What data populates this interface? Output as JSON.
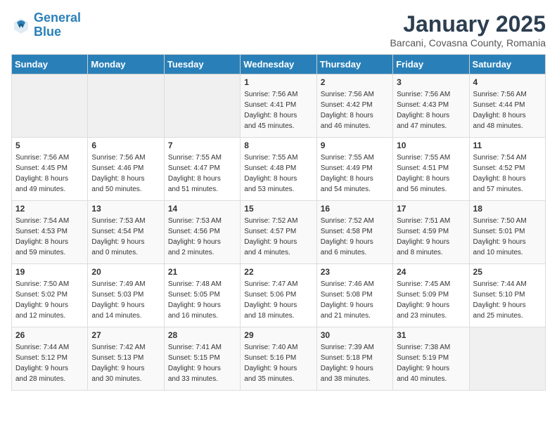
{
  "logo": {
    "line1": "General",
    "line2": "Blue"
  },
  "title": "January 2025",
  "subtitle": "Barcani, Covasna County, Romania",
  "weekdays": [
    "Sunday",
    "Monday",
    "Tuesday",
    "Wednesday",
    "Thursday",
    "Friday",
    "Saturday"
  ],
  "weeks": [
    [
      {
        "day": "",
        "info": ""
      },
      {
        "day": "",
        "info": ""
      },
      {
        "day": "",
        "info": ""
      },
      {
        "day": "1",
        "info": "Sunrise: 7:56 AM\nSunset: 4:41 PM\nDaylight: 8 hours\nand 45 minutes."
      },
      {
        "day": "2",
        "info": "Sunrise: 7:56 AM\nSunset: 4:42 PM\nDaylight: 8 hours\nand 46 minutes."
      },
      {
        "day": "3",
        "info": "Sunrise: 7:56 AM\nSunset: 4:43 PM\nDaylight: 8 hours\nand 47 minutes."
      },
      {
        "day": "4",
        "info": "Sunrise: 7:56 AM\nSunset: 4:44 PM\nDaylight: 8 hours\nand 48 minutes."
      }
    ],
    [
      {
        "day": "5",
        "info": "Sunrise: 7:56 AM\nSunset: 4:45 PM\nDaylight: 8 hours\nand 49 minutes."
      },
      {
        "day": "6",
        "info": "Sunrise: 7:56 AM\nSunset: 4:46 PM\nDaylight: 8 hours\nand 50 minutes."
      },
      {
        "day": "7",
        "info": "Sunrise: 7:55 AM\nSunset: 4:47 PM\nDaylight: 8 hours\nand 51 minutes."
      },
      {
        "day": "8",
        "info": "Sunrise: 7:55 AM\nSunset: 4:48 PM\nDaylight: 8 hours\nand 53 minutes."
      },
      {
        "day": "9",
        "info": "Sunrise: 7:55 AM\nSunset: 4:49 PM\nDaylight: 8 hours\nand 54 minutes."
      },
      {
        "day": "10",
        "info": "Sunrise: 7:55 AM\nSunset: 4:51 PM\nDaylight: 8 hours\nand 56 minutes."
      },
      {
        "day": "11",
        "info": "Sunrise: 7:54 AM\nSunset: 4:52 PM\nDaylight: 8 hours\nand 57 minutes."
      }
    ],
    [
      {
        "day": "12",
        "info": "Sunrise: 7:54 AM\nSunset: 4:53 PM\nDaylight: 8 hours\nand 59 minutes."
      },
      {
        "day": "13",
        "info": "Sunrise: 7:53 AM\nSunset: 4:54 PM\nDaylight: 9 hours\nand 0 minutes."
      },
      {
        "day": "14",
        "info": "Sunrise: 7:53 AM\nSunset: 4:56 PM\nDaylight: 9 hours\nand 2 minutes."
      },
      {
        "day": "15",
        "info": "Sunrise: 7:52 AM\nSunset: 4:57 PM\nDaylight: 9 hours\nand 4 minutes."
      },
      {
        "day": "16",
        "info": "Sunrise: 7:52 AM\nSunset: 4:58 PM\nDaylight: 9 hours\nand 6 minutes."
      },
      {
        "day": "17",
        "info": "Sunrise: 7:51 AM\nSunset: 4:59 PM\nDaylight: 9 hours\nand 8 minutes."
      },
      {
        "day": "18",
        "info": "Sunrise: 7:50 AM\nSunset: 5:01 PM\nDaylight: 9 hours\nand 10 minutes."
      }
    ],
    [
      {
        "day": "19",
        "info": "Sunrise: 7:50 AM\nSunset: 5:02 PM\nDaylight: 9 hours\nand 12 minutes."
      },
      {
        "day": "20",
        "info": "Sunrise: 7:49 AM\nSunset: 5:03 PM\nDaylight: 9 hours\nand 14 minutes."
      },
      {
        "day": "21",
        "info": "Sunrise: 7:48 AM\nSunset: 5:05 PM\nDaylight: 9 hours\nand 16 minutes."
      },
      {
        "day": "22",
        "info": "Sunrise: 7:47 AM\nSunset: 5:06 PM\nDaylight: 9 hours\nand 18 minutes."
      },
      {
        "day": "23",
        "info": "Sunrise: 7:46 AM\nSunset: 5:08 PM\nDaylight: 9 hours\nand 21 minutes."
      },
      {
        "day": "24",
        "info": "Sunrise: 7:45 AM\nSunset: 5:09 PM\nDaylight: 9 hours\nand 23 minutes."
      },
      {
        "day": "25",
        "info": "Sunrise: 7:44 AM\nSunset: 5:10 PM\nDaylight: 9 hours\nand 25 minutes."
      }
    ],
    [
      {
        "day": "26",
        "info": "Sunrise: 7:44 AM\nSunset: 5:12 PM\nDaylight: 9 hours\nand 28 minutes."
      },
      {
        "day": "27",
        "info": "Sunrise: 7:42 AM\nSunset: 5:13 PM\nDaylight: 9 hours\nand 30 minutes."
      },
      {
        "day": "28",
        "info": "Sunrise: 7:41 AM\nSunset: 5:15 PM\nDaylight: 9 hours\nand 33 minutes."
      },
      {
        "day": "29",
        "info": "Sunrise: 7:40 AM\nSunset: 5:16 PM\nDaylight: 9 hours\nand 35 minutes."
      },
      {
        "day": "30",
        "info": "Sunrise: 7:39 AM\nSunset: 5:18 PM\nDaylight: 9 hours\nand 38 minutes."
      },
      {
        "day": "31",
        "info": "Sunrise: 7:38 AM\nSunset: 5:19 PM\nDaylight: 9 hours\nand 40 minutes."
      },
      {
        "day": "",
        "info": ""
      }
    ]
  ]
}
